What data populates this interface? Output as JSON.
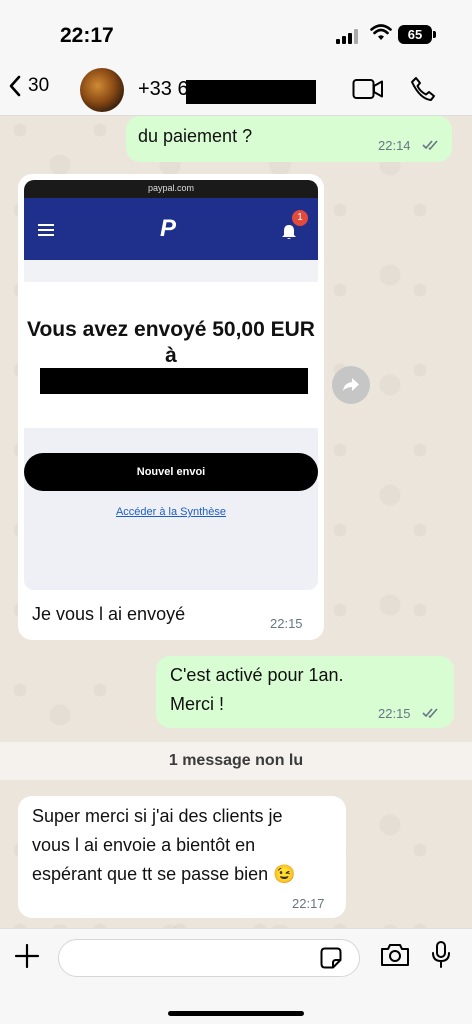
{
  "status_bar": {
    "time": "22:17",
    "battery": "65"
  },
  "header": {
    "back_count": "30",
    "contact_name": "+33 6"
  },
  "messages": {
    "m1": {
      "text": "du paiement ?",
      "time": "22:14"
    },
    "m2": {
      "caption": "Je vous l ai envoyé",
      "time": "22:15"
    },
    "m3": {
      "line1": "C'est activé pour 1an.",
      "line2": "Merci !",
      "time": "22:15"
    },
    "m4": {
      "line1": "Super merci si j'ai des clients je",
      "line2": "vous l ai envoie a bientôt en",
      "line3": "espérant que tt se passe bien 😉",
      "time": "22:17"
    }
  },
  "paypal": {
    "url": "paypal.com",
    "logo": "P",
    "notification_count": "1",
    "amount_text": "Vous avez envoyé 50,00 EUR",
    "to_text": "à",
    "button_label": "Nouvel envoi",
    "link_label": "Accéder à la Synthèse"
  },
  "unread_banner": "1 message non lu",
  "colors": {
    "outgoing": "#d9fdd3",
    "incoming": "#ffffff",
    "paypal_blue": "#1f2f8c"
  }
}
